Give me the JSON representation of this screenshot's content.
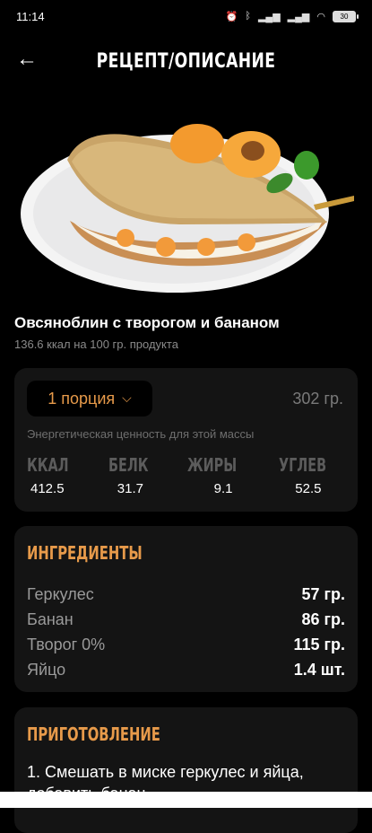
{
  "status": {
    "time": "11:14",
    "icons": [
      "alarm-icon",
      "bluetooth-icon",
      "signal-icon",
      "signal-icon",
      "wifi-icon"
    ],
    "battery": "30"
  },
  "header": {
    "title": "РЕЦЕПТ/ОПИСАНИЕ",
    "back_icon": "arrow-left-icon"
  },
  "dish": {
    "name": "Овсяноблин с творогом и бананом",
    "kcal_note": "136.6 ккал на 100 гр. продукта"
  },
  "nutrition": {
    "portion_label": "1 порция",
    "portion_icon": "chevron-down-icon",
    "weight": "302 гр.",
    "energy_note": "Энергетическая ценность для этой массы",
    "macros": [
      {
        "label": "ККАЛ",
        "value": "412.5"
      },
      {
        "label": "БЕЛК",
        "value": "31.7"
      },
      {
        "label": "ЖИРЫ",
        "value": "9.1"
      },
      {
        "label": "УГЛЕВ",
        "value": "52.5"
      }
    ]
  },
  "ingredients": {
    "title": "ИНГРЕДИЕНТЫ",
    "items": [
      {
        "name": "Геркулес",
        "qty": "57 гр."
      },
      {
        "name": "Банан",
        "qty": "86 гр."
      },
      {
        "name": "Творог 0%",
        "qty": "115 гр."
      },
      {
        "name": "Яйцо",
        "qty": "1.4 шт."
      }
    ]
  },
  "preparation": {
    "title": "ПРИГОТОВЛЕНИЕ",
    "text": "1. Смешать в миске геркулес и яйца, добавить банан"
  },
  "colors": {
    "accent": "#e79a4a",
    "background": "#000000",
    "card": "#141414"
  }
}
